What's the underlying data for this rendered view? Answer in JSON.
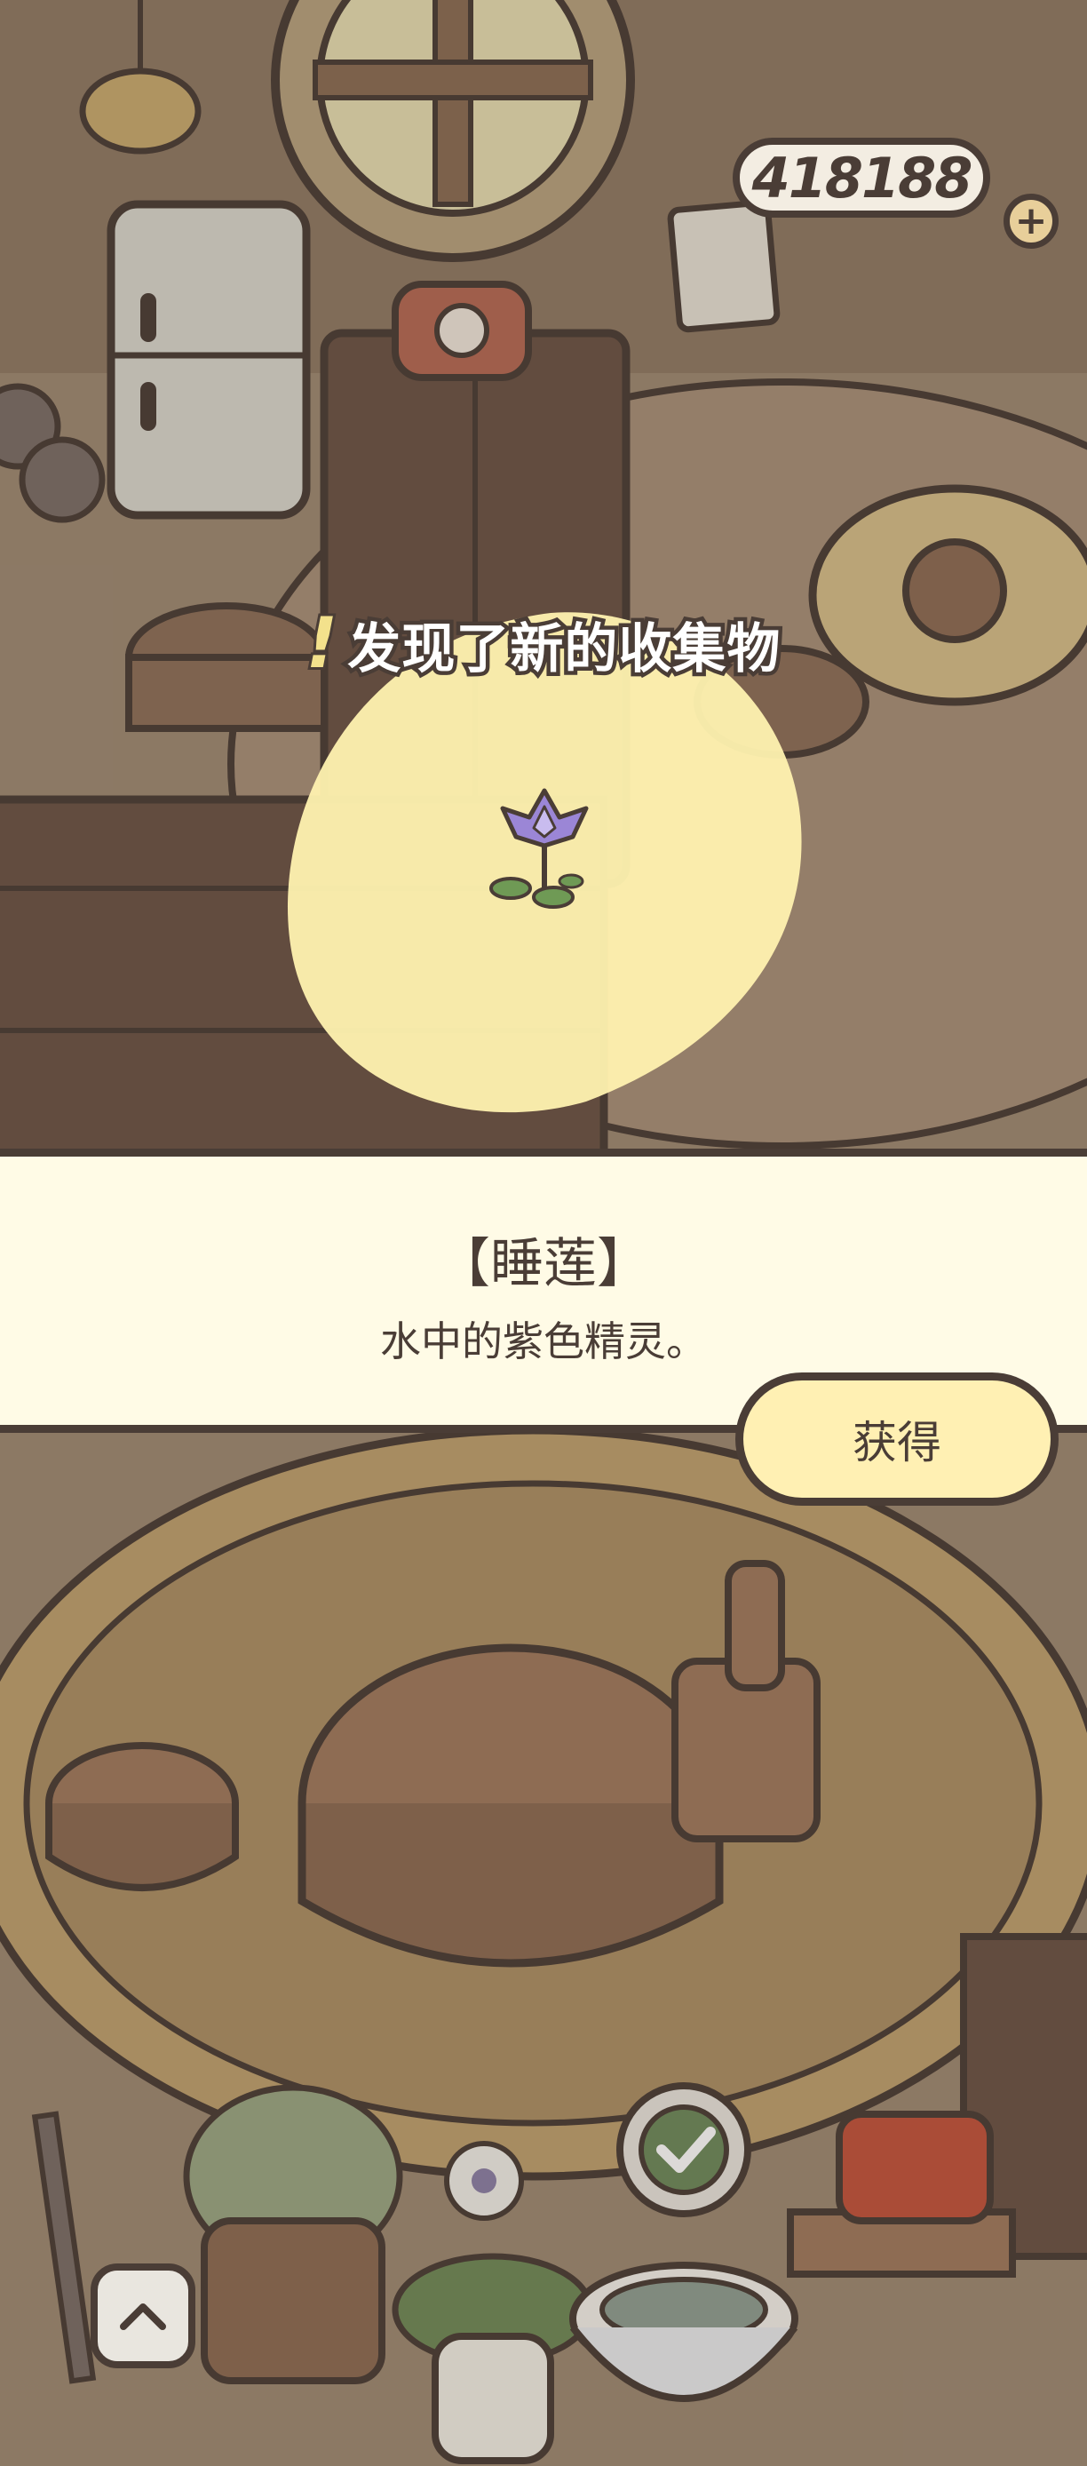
{
  "hud": {
    "clover_count": "418188",
    "add_label": "+"
  },
  "discovery": {
    "exclamation": "!",
    "title": "发现了新的收集物"
  },
  "item": {
    "name": "【睡莲】",
    "description": "水中的紫色精灵。",
    "icon": "water-lily-icon"
  },
  "actions": {
    "obtain_label": "获得"
  },
  "colors": {
    "outline": "#4a3d36",
    "panel_bg": "#fffbe6",
    "button_bg": "#fff0b3",
    "spotlight": "#fff2b0",
    "lily_petal": "#9b86d6"
  }
}
